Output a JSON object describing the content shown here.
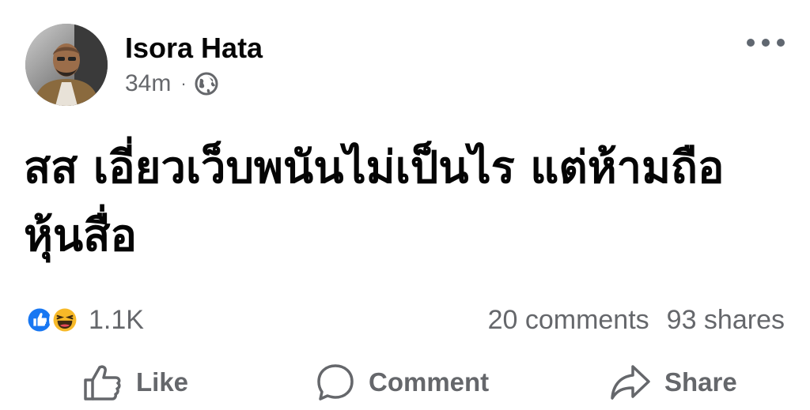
{
  "post": {
    "author": "Isora Hata",
    "time": "34m",
    "separator": "·",
    "audience_icon": "globe-icon",
    "more_icon": "more-horizontal-icon",
    "text": "สส เอี่ยวเว็บพนันไม่เป็นไร แต่ห้ามถือหุ้นสื่อ"
  },
  "stats": {
    "reaction_icons": [
      "like-reaction-icon",
      "haha-reaction-icon"
    ],
    "reaction_count": "1.1K",
    "comments": "20 comments",
    "shares": "93 shares"
  },
  "actions": {
    "like": "Like",
    "comment": "Comment",
    "share": "Share"
  },
  "colors": {
    "text_primary": "#050505",
    "text_secondary": "#65676b",
    "like_blue": "#1877f2",
    "haha_yellow": "#f7b928"
  }
}
